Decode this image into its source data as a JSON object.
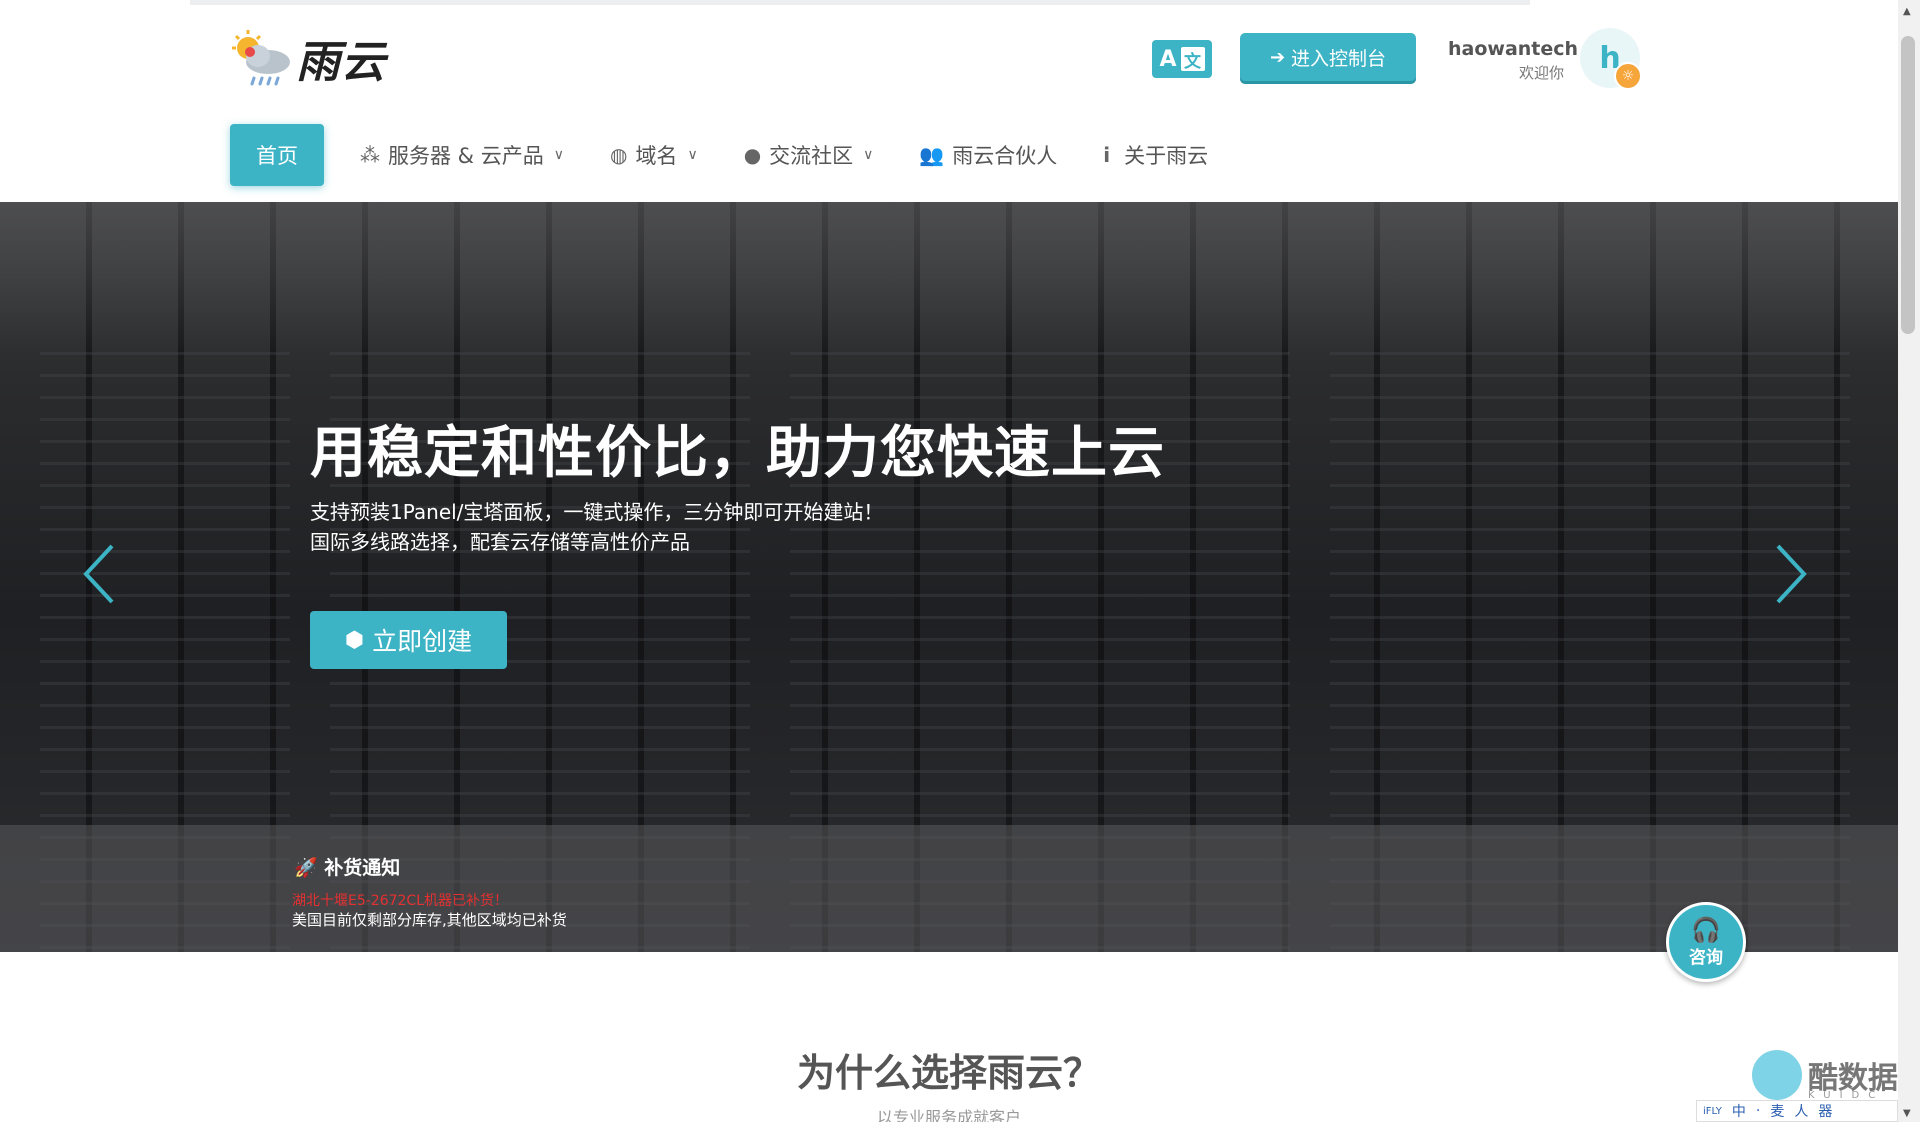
{
  "header": {
    "logo_text": "雨云",
    "lang_button": {
      "a": "A",
      "zh": "文"
    },
    "console_button": "进入控制台",
    "user": {
      "name": "haowantech",
      "welcome": "欢迎你",
      "avatar_letter": "h"
    }
  },
  "nav": {
    "items": [
      {
        "label": "首页"
      },
      {
        "label": "服务器 & 云产品"
      },
      {
        "label": "域名"
      },
      {
        "label": "交流社区"
      },
      {
        "label": "雨云合伙人"
      },
      {
        "label": "关于雨云"
      }
    ]
  },
  "hero": {
    "title": "用稳定和性价比，助力您快速上云",
    "subtitle1": "支持预装1Panel/宝塔面板，一键式操作，三分钟即可开始建站！",
    "subtitle2": "国际多线路选择，配套云存储等高性价产品",
    "create_button": "立即创建"
  },
  "notice": {
    "title": "补货通知",
    "red_line": "湖北十堰E5-2672CL机器已补货！",
    "white_line": "美国目前仅剩部分库存,其他区域均已补货"
  },
  "consult": {
    "label": "咨询"
  },
  "section": {
    "title": "为什么选择雨云？",
    "subtitle": "以专业服务成就客户"
  },
  "watermark": {
    "text": "酷数据",
    "sub": "KUIDC"
  },
  "tray": {
    "items": [
      "iFLY",
      "中",
      "·",
      "麦",
      "人",
      "器"
    ]
  },
  "colors": {
    "accent": "#3db4c5",
    "notice_red": "#e53030"
  }
}
